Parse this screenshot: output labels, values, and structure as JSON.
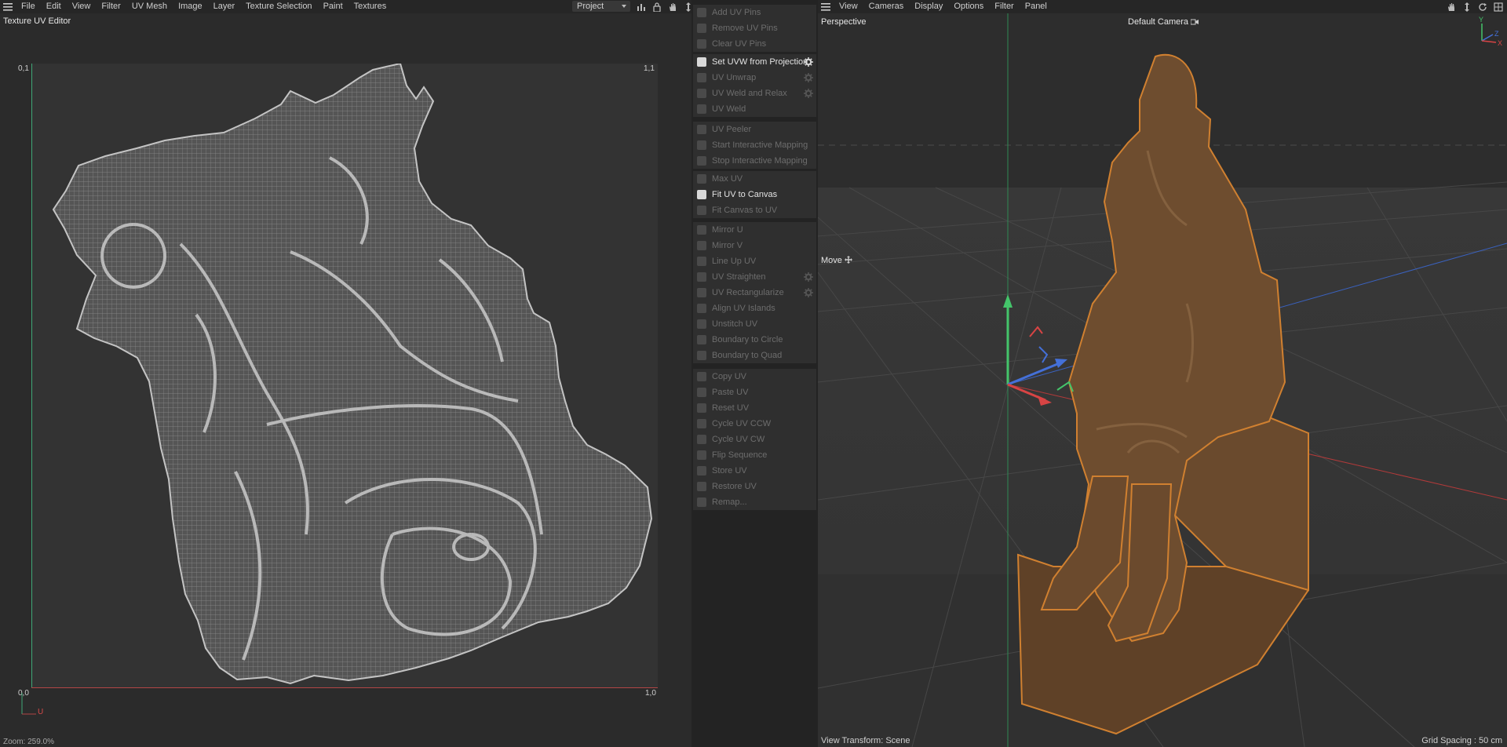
{
  "uv_editor": {
    "menu": [
      "File",
      "Edit",
      "View",
      "Filter",
      "UV Mesh",
      "Image",
      "Layer",
      "Texture Selection",
      "Paint",
      "Textures"
    ],
    "project_select": "Project",
    "title": "Texture UV Editor",
    "corners": {
      "top_left": "0,1",
      "top_right": "1,1",
      "bottom_left": "0,0",
      "bottom_right": "1,0"
    },
    "axis_u": "U",
    "zoom": "Zoom: 259.0%",
    "colors": {
      "v_axis": "#3fa777",
      "u_axis": "#b24646",
      "mesh": "#9a9a9a"
    }
  },
  "tools": {
    "groups": [
      [
        {
          "label": "Add UV Pins",
          "enabled": false,
          "gear": false
        },
        {
          "label": "Remove UV Pins",
          "enabled": false,
          "gear": false
        },
        {
          "label": "Clear UV Pins",
          "enabled": false,
          "gear": false
        }
      ],
      [
        {
          "label": "Set UVW from Projection",
          "enabled": true,
          "gear": true
        },
        {
          "label": "UV Unwrap",
          "enabled": false,
          "gear": true
        },
        {
          "label": "UV Weld and Relax",
          "enabled": false,
          "gear": true
        },
        {
          "label": "UV Weld",
          "enabled": false,
          "gear": false
        }
      ],
      [
        {
          "label": "UV Peeler",
          "enabled": false,
          "gear": false
        },
        {
          "label": "Start Interactive Mapping",
          "enabled": false,
          "gear": false
        },
        {
          "label": "Stop Interactive Mapping",
          "enabled": false,
          "gear": false
        }
      ],
      [
        {
          "label": "Max UV",
          "enabled": false,
          "gear": false
        },
        {
          "label": "Fit UV to Canvas",
          "enabled": true,
          "gear": false
        },
        {
          "label": "Fit Canvas to UV",
          "enabled": false,
          "gear": false
        }
      ],
      [
        {
          "label": "Mirror U",
          "enabled": false,
          "gear": false
        },
        {
          "label": "Mirror V",
          "enabled": false,
          "gear": false
        },
        {
          "label": "Line Up UV",
          "enabled": false,
          "gear": false
        },
        {
          "label": "UV Straighten",
          "enabled": false,
          "gear": true
        },
        {
          "label": "UV Rectangularize",
          "enabled": false,
          "gear": true
        },
        {
          "label": "Align UV Islands",
          "enabled": false,
          "gear": false
        },
        {
          "label": "Unstitch UV",
          "enabled": false,
          "gear": false
        },
        {
          "label": "Boundary to Circle",
          "enabled": false,
          "gear": false
        },
        {
          "label": "Boundary to Quad",
          "enabled": false,
          "gear": false
        }
      ],
      [
        {
          "label": "Copy UV",
          "enabled": false,
          "gear": false
        },
        {
          "label": "Paste UV",
          "enabled": false,
          "gear": false
        },
        {
          "label": "Reset UV",
          "enabled": false,
          "gear": false
        },
        {
          "label": "Cycle UV CCW",
          "enabled": false,
          "gear": false
        },
        {
          "label": "Cycle UV CW",
          "enabled": false,
          "gear": false
        },
        {
          "label": "Flip Sequence",
          "enabled": false,
          "gear": false
        },
        {
          "label": "Store UV",
          "enabled": false,
          "gear": false
        },
        {
          "label": "Restore UV",
          "enabled": false,
          "gear": false
        },
        {
          "label": "Remap...",
          "enabled": false,
          "gear": false
        }
      ]
    ]
  },
  "viewport": {
    "menu": [
      "View",
      "Cameras",
      "Display",
      "Options",
      "Filter",
      "Panel"
    ],
    "projection": "Perspective",
    "camera": "Default Camera",
    "tool": "Move",
    "view_transform": "View Transform: Scene",
    "grid_spacing": "Grid Spacing : 50 cm",
    "gizmo_axes": {
      "x": "X",
      "y": "Y",
      "z": "Z"
    },
    "colors": {
      "statue": "#6b4a2c",
      "outline": "#d08030",
      "x_axis": "#d84444",
      "y_axis": "#44c46a",
      "z_axis": "#4470d8"
    }
  }
}
